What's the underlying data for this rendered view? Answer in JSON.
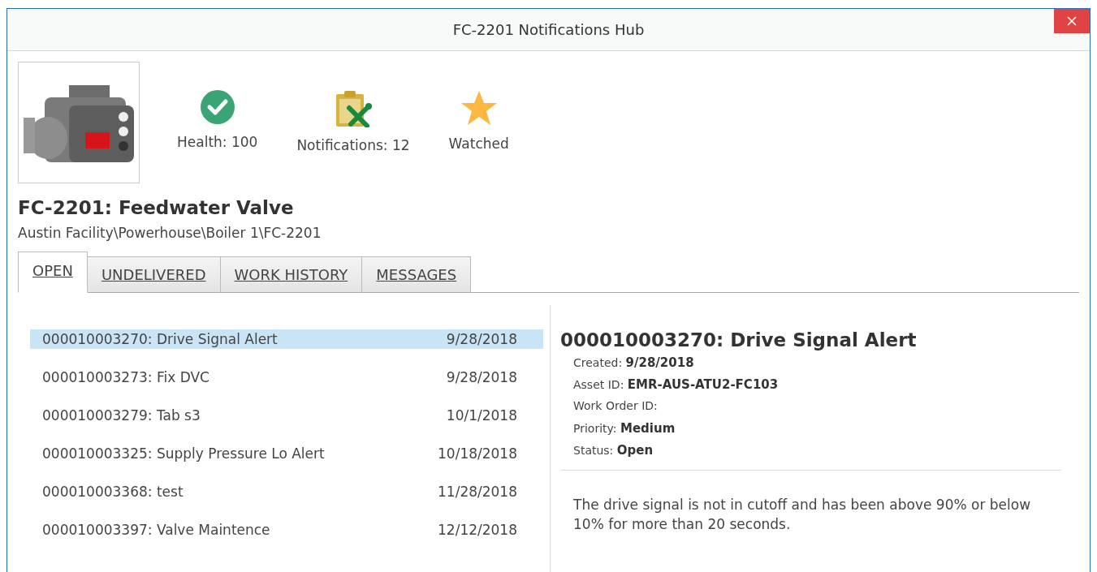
{
  "window": {
    "title": "FC-2201 Notifications Hub"
  },
  "stats": [
    {
      "kind": "health",
      "label": "Health: 100"
    },
    {
      "kind": "notifications",
      "label": "Notifications: 12"
    },
    {
      "kind": "watched",
      "label": "Watched"
    }
  ],
  "asset": {
    "title": "FC-2201: Feedwater Valve",
    "path": "Austin Facility\\Powerhouse\\Boiler 1\\FC-2201"
  },
  "tabs": [
    {
      "label": "OPEN",
      "selected": true
    },
    {
      "label": "UNDELIVERED",
      "selected": false
    },
    {
      "label": "WORK HISTORY",
      "selected": false
    },
    {
      "label": "MESSAGES",
      "selected": false
    }
  ],
  "notifications": [
    {
      "name": "000010003270: Drive Signal Alert",
      "date": "9/28/2018",
      "selected": true
    },
    {
      "name": "000010003273: Fix DVC",
      "date": "9/28/2018",
      "selected": false
    },
    {
      "name": "000010003279: Tab s3",
      "date": "10/1/2018",
      "selected": false
    },
    {
      "name": "000010003325: Supply Pressure Lo Alert",
      "date": "10/18/2018",
      "selected": false
    },
    {
      "name": "000010003368: test",
      "date": "11/28/2018",
      "selected": false
    },
    {
      "name": "000010003397: Valve Maintence",
      "date": "12/12/2018",
      "selected": false
    }
  ],
  "detail": {
    "title": "000010003270: Drive Signal Alert",
    "fields": [
      "Created: **9/28/2018**",
      "Asset ID: **EMR-AUS-ATU2-FC103**",
      "Work Order ID:",
      "Priority: **Medium**",
      "Status: **Open**"
    ],
    "description": "The drive signal is not in cutoff and has been above 90% or below 10% for more than 20 seconds."
  }
}
